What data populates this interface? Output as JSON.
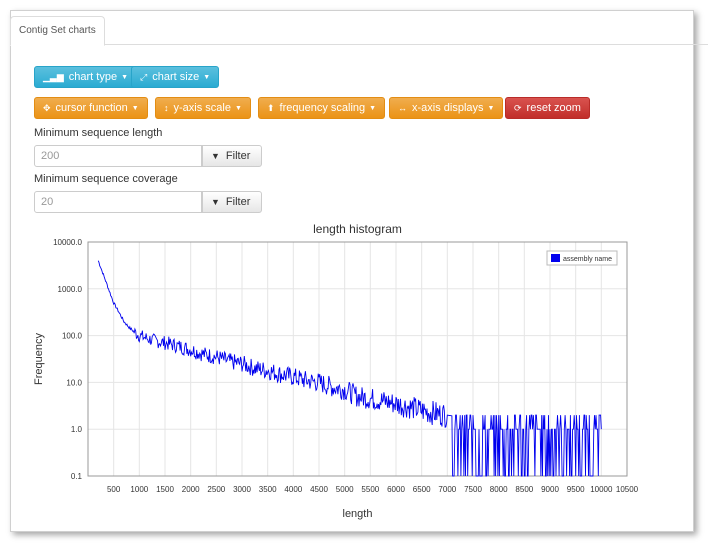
{
  "tab": {
    "label": "Contig Set charts"
  },
  "toolbar": {
    "chart_type": "chart type",
    "chart_size": "chart size",
    "cursor_function": "cursor function",
    "y_axis_scale": "y-axis scale",
    "frequency_scaling": "frequency scaling",
    "x_axis_displays": "x-axis displays",
    "reset_zoom": "reset zoom"
  },
  "filters": {
    "min_length": {
      "label": "Minimum sequence length",
      "value": "200",
      "button": "Filter"
    },
    "min_coverage": {
      "label": "Minimum sequence coverage",
      "value": "20",
      "button": "Filter"
    }
  },
  "colors": {
    "info": "#5bc0de",
    "warning": "#f0ad4e",
    "danger": "#d9534f",
    "series": "#0000ee"
  },
  "icons": {
    "chart_type": "bar-chart-icon",
    "chart_size": "resize-icon",
    "cursor_function": "move-icon",
    "y_axis_scale": "vertical-resize-icon",
    "frequency_scaling": "circle-up-icon",
    "x_axis_displays": "horizontal-resize-icon",
    "reset_zoom": "refresh-icon",
    "filter": "filter-icon"
  },
  "chart_data": {
    "type": "line",
    "title": "length histogram",
    "xlabel": "length",
    "ylabel": "Frequency",
    "xlim": [
      0,
      10500
    ],
    "ylim": [
      0.1,
      10000
    ],
    "yscale": "log",
    "xticks": [
      "500",
      "1000",
      "1500",
      "2000",
      "2500",
      "3000",
      "3500",
      "4000",
      "4500",
      "5000",
      "5500",
      "6000",
      "6500",
      "7000",
      "7500",
      "8000",
      "8500",
      "9000",
      "9500",
      "10000",
      "10500"
    ],
    "yticks": [
      "0.1",
      "1.0",
      "10.0",
      "100.0",
      "1000.0",
      "10000.0"
    ],
    "grid": true,
    "legend_position": "top-right",
    "series": [
      {
        "name": "assembly name",
        "x": [
          200,
          300,
          400,
          500,
          600,
          700,
          800,
          900,
          1000,
          1250,
          1500,
          1750,
          2000,
          2250,
          2500,
          2750,
          3000,
          3250,
          3500,
          3750,
          4000,
          4250,
          4500,
          4750,
          5000,
          5250,
          5500,
          5750,
          6000,
          6250,
          6500,
          6750,
          7000,
          7250,
          7500,
          7750,
          8000,
          8250,
          8500,
          8750,
          9000,
          9250,
          9500,
          9750,
          10000
        ],
        "values": [
          4000,
          2000,
          1000,
          500,
          320,
          200,
          150,
          120,
          100,
          80,
          70,
          60,
          50,
          40,
          35,
          28,
          25,
          20,
          18,
          15,
          13,
          11,
          10,
          8,
          7,
          5,
          4.5,
          4,
          3.5,
          3,
          2.5,
          2.2,
          2,
          1.8,
          1.6,
          1.5,
          1.4,
          1.3,
          1.2,
          1.15,
          1.1,
          1.05,
          1,
          1,
          1
        ]
      }
    ]
  }
}
